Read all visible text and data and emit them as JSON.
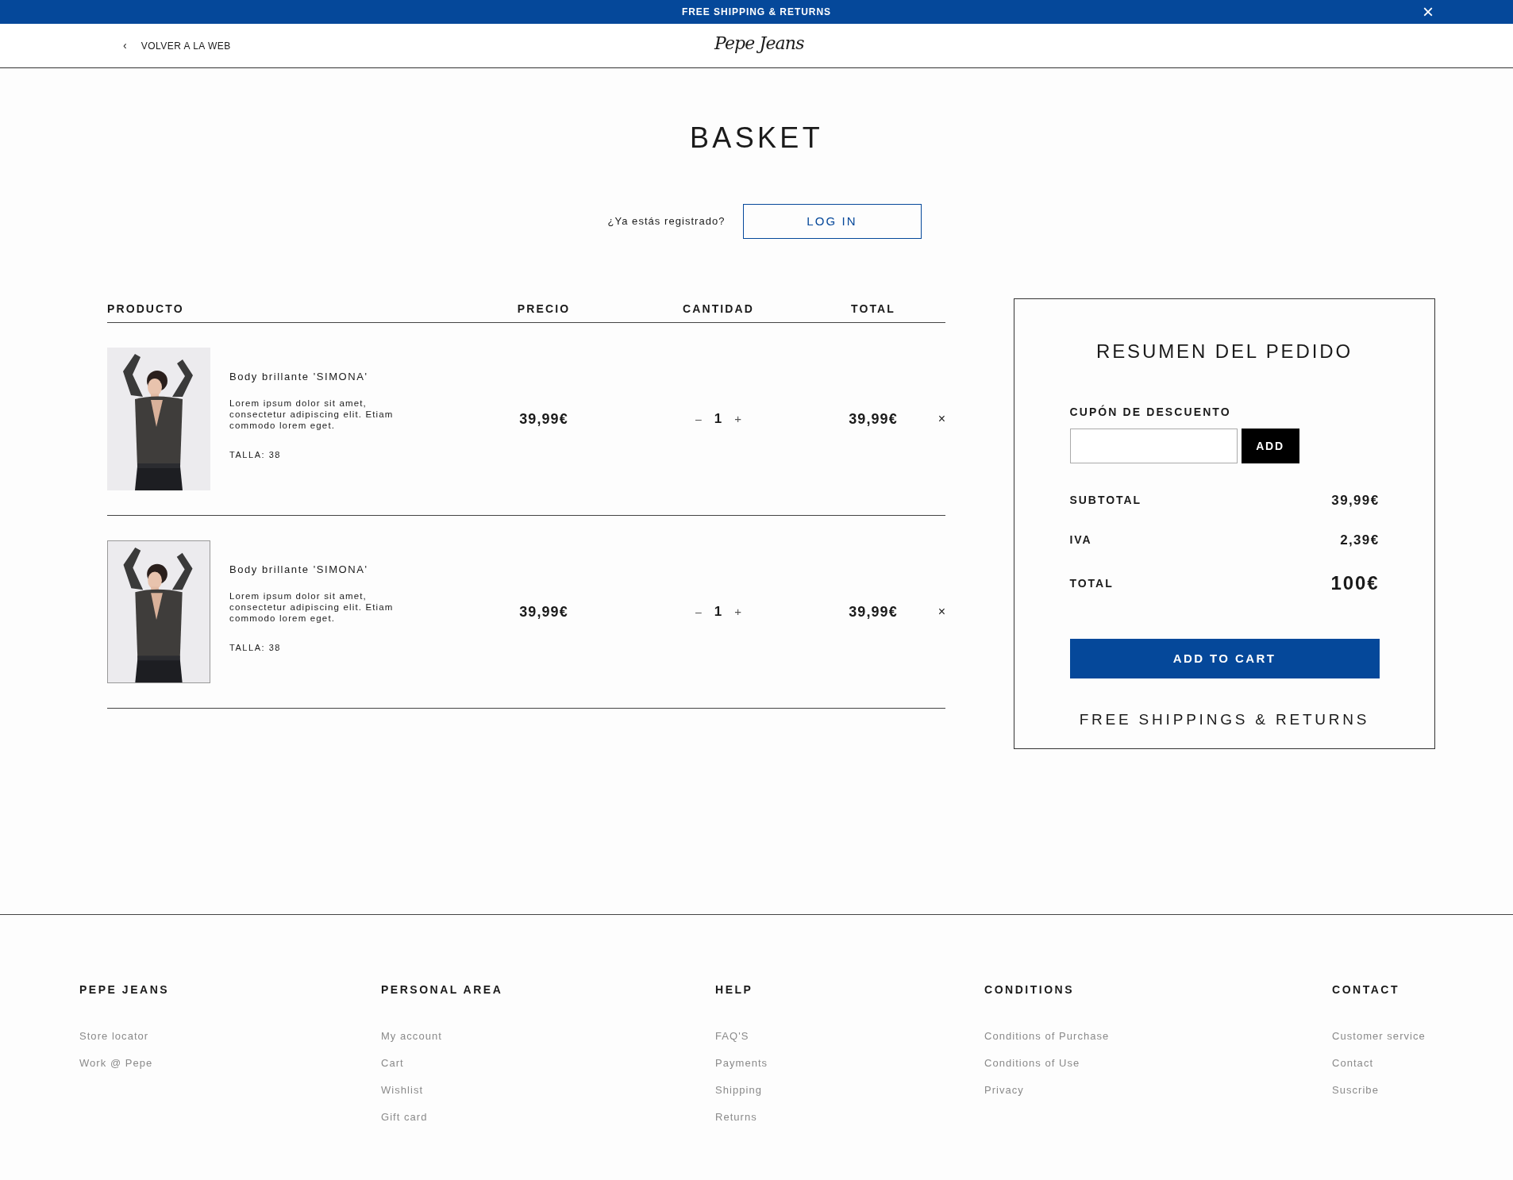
{
  "promo_bar": {
    "text": "FREE SHIPPING & RETURNS",
    "close": "×"
  },
  "header": {
    "back_icon": "‹",
    "back_link": "VOLVER A LA WEB",
    "logo": "Pepe Jeans"
  },
  "page_title": "BASKET",
  "login": {
    "prompt": "¿Ya estás registrado?",
    "button": "LOG IN"
  },
  "table": {
    "columns": [
      "PRODUCTO",
      "PRECIO",
      "CANTIDAD",
      "TOTAL"
    ],
    "rows": [
      {
        "name": "Body brillante 'SIMONA'",
        "description": "Lorem ipsum dolor sit amet, consectetur adipiscing elit. Etiam commodo lorem eget.",
        "size": "TALLA: 38",
        "price": "39,99€",
        "minus": "–",
        "quantity": "1",
        "plus": "+",
        "total": "39,99€",
        "remove": "×",
        "image_bordered": false
      },
      {
        "name": "Body brillante 'SIMONA'",
        "description": "Lorem ipsum dolor sit amet, consectetur adipiscing elit. Etiam commodo lorem eget.",
        "size": "TALLA: 38",
        "price": "39,99€",
        "minus": "–",
        "quantity": "1",
        "plus": "+",
        "total": "39,99€",
        "remove": "×",
        "image_bordered": true
      }
    ]
  },
  "summary": {
    "title": "RESUMEN DEL PEDIDO",
    "coupon_label": "CUPÓN DE DESCUENTO",
    "coupon_button": "ADD",
    "lines": [
      {
        "label": "SUBTOTAL",
        "value": "39,99€",
        "kind": "normal"
      },
      {
        "label": "IVA",
        "value": "2,39€",
        "kind": "normal"
      },
      {
        "label": "TOTAL",
        "value": "100€",
        "kind": "grand"
      }
    ],
    "cta": "ADD TO CART",
    "note": "FREE SHIPPINGS & RETURNS"
  },
  "footer": {
    "columns": [
      {
        "heading": "PEPE JEANS",
        "links": [
          "Store locator",
          "Work @ Pepe"
        ]
      },
      {
        "heading": "PERSONAL AREA",
        "links": [
          "My account",
          "Cart",
          "Wishlist",
          "Gift card"
        ]
      },
      {
        "heading": "HELP",
        "links": [
          "FAQ'S",
          "Payments",
          "Shipping",
          "Returns"
        ]
      },
      {
        "heading": "CONDITIONS",
        "links": [
          "Conditions of Purchase",
          "Conditions of Use",
          "Privacy"
        ]
      },
      {
        "heading": "CONTACT",
        "links": [
          "Customer service",
          "Contact",
          "Suscribe"
        ]
      }
    ]
  }
}
